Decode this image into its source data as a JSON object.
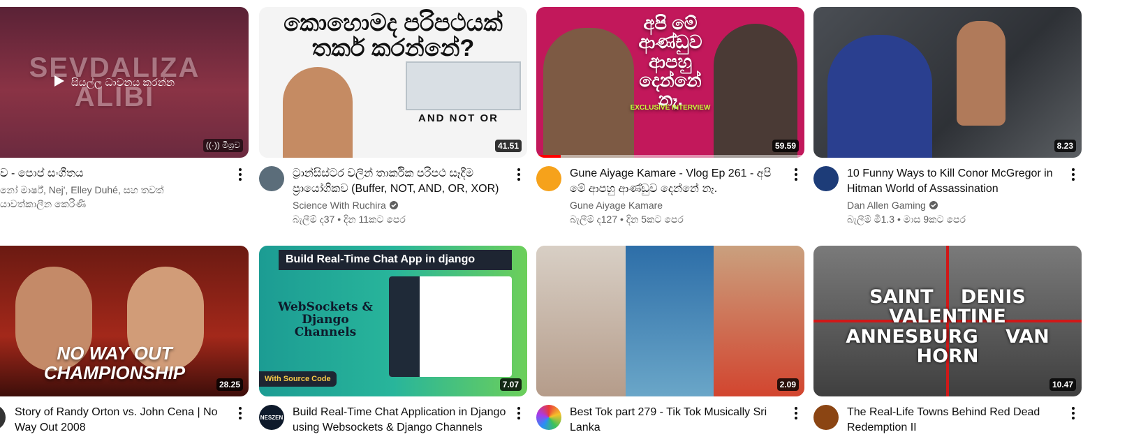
{
  "row1": [
    {
      "thumb_text": "SEVDALIZA ALIBI",
      "play_label": "සියල්ල ධාවනය කරන්න",
      "badge": "මිශ්‍රව",
      "title": "ව - පොප් සංගීතය",
      "channel": "නෝ මාර්ෂ්, Nej', Elley Duhé, සහ තවත්",
      "stats": "යාවත්කාලීන කෙරිණි",
      "colors": {
        "thumb": "#6b2a3f"
      }
    },
    {
      "thumb_text": "කොහොමද පරිපථයක් තර්ක කරන්නේ?",
      "thumb_sub": "AND  NOT  OR",
      "duration": "41.51",
      "title": "ට්‍රාන්සිස්ටර වලින් තාර්කික පරිපථ සෑදීම ප්‍රායෝගිකව (Buffer, NOT, AND, OR, XOR)",
      "channel": "Science With Ruchira",
      "stats": "බැලීම් ද37 • දින 11කට පෙර",
      "colors": {
        "thumb": "#f4f4f4",
        "avatar": "#5b6d7a"
      }
    },
    {
      "thumb_text": "අපි මේ ආණ්ඩුව ආපහු දෙන්නේ නෑ.",
      "thumb_sub": "EXCLUSIVE INTERVIEW",
      "duration": "59.59",
      "title": "Gune Aiyage Kamare - Vlog Ep 261 - අපි මේ ආපහු ආණ්ඩුව දෙන්නේ නෑ.",
      "channel": "Gune Aiyage Kamare",
      "stats": "බැලීම් ද127 • දින 5කට පෙර",
      "progress": 0.09,
      "colors": {
        "thumb": "#c2185b",
        "avatar": "#f6a21b"
      }
    },
    {
      "thumb_text": "",
      "duration": "8.23",
      "title": "10 Funny Ways to Kill Conor McGregor in Hitman World of Assassination",
      "channel": "Dan Allen Gaming",
      "stats": "බැලීම් මි1.3 • මාස 9කට පෙර",
      "colors": {
        "thumb": "#3a3d42",
        "avatar": "#1d3c78"
      }
    }
  ],
  "row2": [
    {
      "thumb_text": "NO WAY OUT CHAMPIONSHIP",
      "duration": "28.25",
      "title": "Story of Randy Orton vs. John Cena | No Way Out 2008",
      "colors": {
        "thumb": "#7a1a12",
        "avatar": "#333333"
      }
    },
    {
      "thumb_text": "Build Real-Time Chat App in django",
      "thumb_sub": "WebSockets & Django Channels",
      "thumb_tag": "With Source Code",
      "duration": "7.07",
      "title": "Build Real-Time Chat Application in Django using Websockets & Django Channels",
      "avatar_text": "NESZEN",
      "colors": {
        "thumb": "#1fa88a",
        "avatar": "#0e1a2b"
      }
    },
    {
      "thumb_text": "",
      "duration": "2.09",
      "title": "Best Tok part 279 - Tik Tok Musically Sri Lanka",
      "colors": {
        "thumb": "#c98a6e",
        "avatar": "#7b3fe4"
      }
    },
    {
      "thumb_text": "SAINT DENIS  VALENTINE  ANNESBURG  VAN HORN",
      "duration": "10.47",
      "title": "The Real-Life Towns Behind Red Dead Redemption II",
      "colors": {
        "thumb": "#555555",
        "avatar": "#8b4513"
      }
    }
  ]
}
